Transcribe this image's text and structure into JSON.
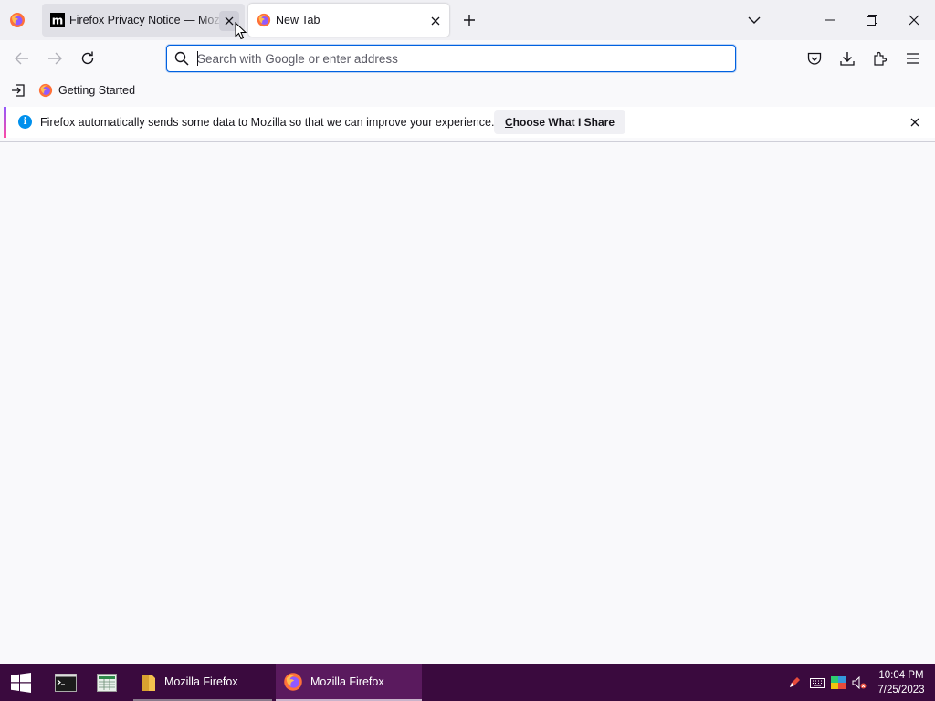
{
  "browser": {
    "tabs": [
      {
        "title": "Firefox Privacy Notice — Mozilla",
        "favicon": "mozilla-m-icon",
        "active": false
      },
      {
        "title": "New Tab",
        "favicon": "firefox-icon",
        "active": true
      }
    ],
    "urlbar": {
      "value": "",
      "placeholder": "Search with Google or enter address"
    },
    "bookmarks": [
      {
        "label": "Getting Started"
      }
    ],
    "notification": {
      "message": "Firefox automatically sends some data to Mozilla so that we can improve your experience.",
      "button_label": "Choose What I Share"
    }
  },
  "taskbar": {
    "apps": [
      {
        "label": "Mozilla Firefox",
        "icon": "folder-icon"
      },
      {
        "label": "Mozilla Firefox",
        "icon": "firefox-icon"
      }
    ],
    "clock": {
      "time": "10:04 PM",
      "date": "7/25/2023"
    }
  },
  "colors": {
    "accent": "#0061e0",
    "taskbar": "#3a0a3e",
    "info": "#0090ed"
  }
}
